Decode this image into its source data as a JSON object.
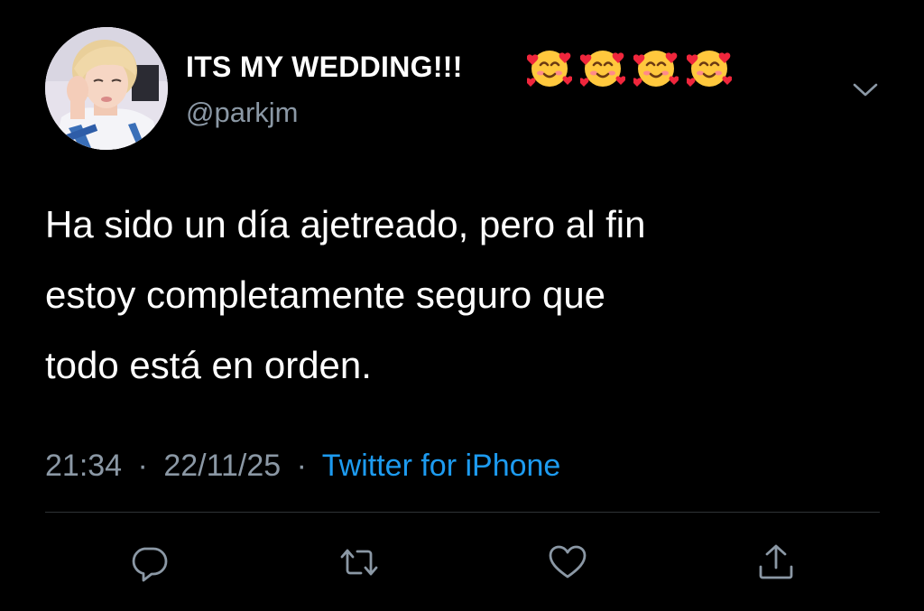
{
  "tweet": {
    "display_name": "ITS MY WEDDING!!!",
    "handle": "@parkjm",
    "emoji_icon": "smiling-face-with-hearts-icon",
    "emoji_count": 4,
    "text_lines": [
      "Ha sido un día ajetreado, pero al fin",
      "estoy completamente seguro que",
      "todo está en orden."
    ],
    "time": "21:34",
    "date": "22/11/25",
    "separator": "·",
    "source": "Twitter for iPhone"
  },
  "actions": {
    "reply_icon": "reply-icon",
    "retweet_icon": "retweet-icon",
    "like_icon": "heart-icon",
    "share_icon": "share-icon"
  },
  "colors": {
    "background": "#000000",
    "text": "#ffffff",
    "muted": "#8b98a5",
    "accent": "#1d9bf0",
    "divider": "#2f3336"
  }
}
